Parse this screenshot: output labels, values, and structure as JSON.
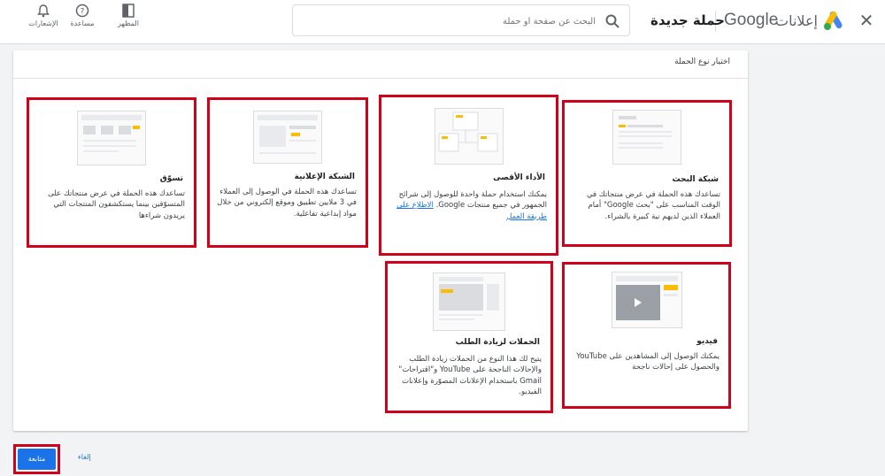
{
  "header": {
    "close_glyph": "✕",
    "brand_google": "Google",
    "brand_product": "إعلانات",
    "page_title": "حملة جديدة",
    "search_placeholder": "البحث عن صفحة أو حملة",
    "tools": [
      {
        "label": "المظهر",
        "icon": "appearance-icon"
      },
      {
        "label": "مساعدة",
        "icon": "help-icon"
      },
      {
        "label": "الإشعارات",
        "icon": "bell-icon"
      }
    ],
    "logo_colors": {
      "blue": "#4285f4",
      "yellow": "#fbbc04",
      "green": "#34a853"
    }
  },
  "panel": {
    "title": "اختيار نوع الحملة",
    "cards": {
      "search": {
        "title": "شبكة البحث",
        "desc": "تساعدك هذه الحملة في عرض منتجاتك في الوقت المناسب على \"بحث Google\" أمام العملاء الذين لديهم نية كبيرة بالشراء."
      },
      "performance_max": {
        "title": "الأداء الأقصى",
        "desc": "يمكنك استخدام حملة واحدة للوصول إلى شرائح الجمهور في جميع منتجات Google.",
        "link": "الاطلاع على طريقة العمل"
      },
      "display": {
        "title": "الشبكة الإعلانية",
        "desc": "تساعدك هذه الحملة في الوصول إلى العملاء في 3 ملايين تطبيق وموقع إلكتروني من خلال مواد إبداعية تفاعلية."
      },
      "shopping": {
        "title": "تسوّق",
        "desc": "تساعدك هذه الحملة في عرض منتجاتك على المتسوّقين بينما يستكشفون المنتجات التي يريدون شراءها"
      },
      "video": {
        "title": "فيديو",
        "desc": "يمكنك الوصول إلى المشاهدين على YouTube والحصول على إحالات ناجحة"
      },
      "demand_gen": {
        "title": "الحملات لزيادة الطلب",
        "desc": "يتيح لك هذا النوع من الحملات زيادة الطلب والإحالات الناجحة على YouTube و\"اقتراحات\" Gmail باستخدام الإعلانات المصوّرة وإعلانات الفيديو."
      }
    }
  },
  "footer": {
    "next_label": "متابعة",
    "cancel_label": "إلغاء"
  },
  "colors": {
    "accent": "#1a73e8",
    "highlight": "#d0021b",
    "thumb_yellow": "#fbbc04"
  }
}
